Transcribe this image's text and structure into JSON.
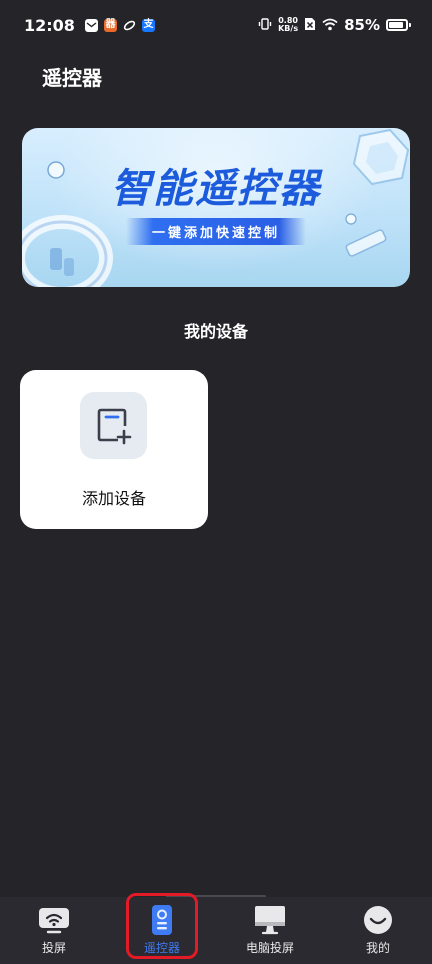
{
  "status_bar": {
    "time": "12:08",
    "alipay_glyph": "支",
    "orange_app_glyph": "器",
    "net_speed_value": "0.80",
    "net_speed_unit": "KB/s",
    "battery": "85%",
    "battery_level": 0.85
  },
  "header": {
    "title": "遥控器"
  },
  "banner": {
    "title": "智能遥控器",
    "subtitle": "一键添加快速控制"
  },
  "devices": {
    "section_title": "我的设备",
    "add_label": "添加设备"
  },
  "bottom_nav": {
    "items": [
      {
        "label": "投屏",
        "icon": "cast-icon"
      },
      {
        "label": "遥控器",
        "icon": "remote-icon"
      },
      {
        "label": "电脑投屏",
        "icon": "monitor-icon"
      },
      {
        "label": "我的",
        "icon": "profile-icon"
      }
    ],
    "active_index": 1
  },
  "colors": {
    "background": "#252429",
    "accent": "#3f7cf4",
    "highlight": "#e21b27",
    "card": "#ffffff"
  }
}
